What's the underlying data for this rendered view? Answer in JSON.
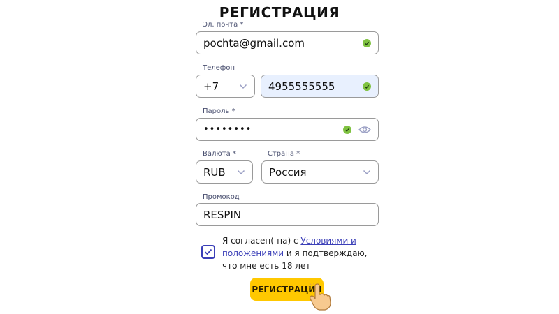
{
  "form": {
    "title": "РЕГИСТРАЦИЯ",
    "email": {
      "label": "Эл. почта *",
      "value": "pochta@gmail.com",
      "valid": true
    },
    "phone": {
      "label": "Телефон",
      "code": "+7",
      "value": "4955555555",
      "valid": true
    },
    "password": {
      "label": "Пароль *",
      "value": "••••••••",
      "valid": true
    },
    "currency": {
      "label": "Валюта *",
      "value": "RUB"
    },
    "country": {
      "label": "Страна *",
      "value": "Россия"
    },
    "promo": {
      "label": "Промокод",
      "value": "RESPIN"
    },
    "agreement": {
      "checked": true,
      "text_before": "Я согласен(-на) с ",
      "link_text": "Условиями и положениями",
      "text_after": " и я подтверждаю, что мне есть 18 лет"
    },
    "submit_label": "РЕГИСТРАЦИЯ"
  },
  "colors": {
    "accent": "#3b3fb8",
    "button": "#ffc800",
    "valid": "#7fc241",
    "highlight": "#e8f0fe"
  },
  "icons": [
    "check-circle-icon",
    "chevron-down-icon",
    "eye-icon",
    "checkbox-check-icon",
    "pointer-hand-icon"
  ]
}
